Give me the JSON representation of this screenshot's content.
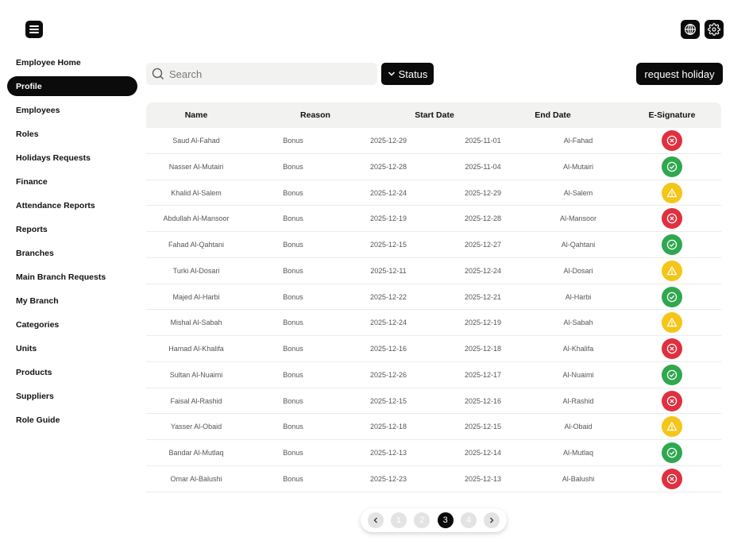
{
  "sidebar": {
    "items": [
      {
        "label": "Employee Home",
        "active": false
      },
      {
        "label": "Profile",
        "active": true
      },
      {
        "label": "Employees",
        "active": false
      },
      {
        "label": "Roles",
        "active": false
      },
      {
        "label": "Holidays Requests",
        "active": false
      },
      {
        "label": "Finance",
        "active": false
      },
      {
        "label": "Attendance Reports",
        "active": false
      },
      {
        "label": "Reports",
        "active": false
      },
      {
        "label": "Branches",
        "active": false
      },
      {
        "label": "Main Branch Requests",
        "active": false
      },
      {
        "label": "My Branch",
        "active": false
      },
      {
        "label": "Categories",
        "active": false
      },
      {
        "label": "Units",
        "active": false
      },
      {
        "label": "Products",
        "active": false
      },
      {
        "label": "Suppliers",
        "active": false
      },
      {
        "label": "Role Guide",
        "active": false
      }
    ]
  },
  "toolbar": {
    "search_placeholder": "Search",
    "status_label": "Status",
    "request_label": "request holiday"
  },
  "icons": {
    "menu": "menu-icon",
    "language": "globe-icon",
    "settings": "gear-icon",
    "search": "search-icon",
    "status_chevron": "chevron-down-icon"
  },
  "table": {
    "headers": [
      "Name",
      "Reason",
      "Start Date",
      "End Date",
      "E-Signature"
    ],
    "rows": [
      {
        "name": "Saud Al-Fahad",
        "reason": "Bonus",
        "start": "2025-12-29",
        "end": "2025-11-01",
        "surname": "Al-Fahad",
        "status": "rejected"
      },
      {
        "name": "Nasser Al-Mutairi",
        "reason": "Bonus",
        "start": "2025-12-28",
        "end": "2025-11-04",
        "surname": "Al-Mutairi",
        "status": "approved"
      },
      {
        "name": "Khalid Al-Salem",
        "reason": "Bonus",
        "start": "2025-12-24",
        "end": "2025-12-29",
        "surname": "Al-Salem",
        "status": "pending"
      },
      {
        "name": "Abdullah Al-Mansoor",
        "reason": "Bonus",
        "start": "2025-12-19",
        "end": "2025-12-28",
        "surname": "Al-Mansoor",
        "status": "rejected"
      },
      {
        "name": "Fahad Al-Qahtani",
        "reason": "Bonus",
        "start": "2025-12-15",
        "end": "2025-12-27",
        "surname": "Al-Qahtani",
        "status": "approved"
      },
      {
        "name": "Turki Al-Dosari",
        "reason": "Bonus",
        "start": "2025-12-11",
        "end": "2025-12-24",
        "surname": "Al-Dosari",
        "status": "pending"
      },
      {
        "name": "Majed Al-Harbi",
        "reason": "Bonus",
        "start": "2025-12-22",
        "end": "2025-12-21",
        "surname": "Al-Harbi",
        "status": "approved"
      },
      {
        "name": "Mishal Al-Sabah",
        "reason": "Bonus",
        "start": "2025-12-24",
        "end": "2025-12-19",
        "surname": "Al-Sabah",
        "status": "pending"
      },
      {
        "name": "Hamad Al-Khalifa",
        "reason": "Bonus",
        "start": "2025-12-16",
        "end": "2025-12-18",
        "surname": "Al-Khalifa",
        "status": "rejected"
      },
      {
        "name": "Sultan Al-Nuaimi",
        "reason": "Bonus",
        "start": "2025-12-26",
        "end": "2025-12-17",
        "surname": "Al-Nuaimi",
        "status": "approved"
      },
      {
        "name": "Faisal Al-Rashid",
        "reason": "Bonus",
        "start": "2025-12-15",
        "end": "2025-12-16",
        "surname": "Al-Rashid",
        "status": "rejected"
      },
      {
        "name": "Yasser Al-Obaid",
        "reason": "Bonus",
        "start": "2025-12-18",
        "end": "2025-12-15",
        "surname": "Al-Obaid",
        "status": "pending"
      },
      {
        "name": "Bandar Al-Mutlaq",
        "reason": "Bonus",
        "start": "2025-12-13",
        "end": "2025-12-14",
        "surname": "Al-Mutlaq",
        "status": "approved"
      },
      {
        "name": "Omar Al-Balushi",
        "reason": "Bonus",
        "start": "2025-12-23",
        "end": "2025-12-13",
        "surname": "Al-Balushi",
        "status": "rejected"
      }
    ]
  },
  "status_colors": {
    "rejected": "#e0303f",
    "approved": "#2fa84f",
    "pending": "#f5c518"
  },
  "pagination": {
    "pages": [
      "1",
      "2",
      "3",
      "4"
    ],
    "current": "3"
  }
}
